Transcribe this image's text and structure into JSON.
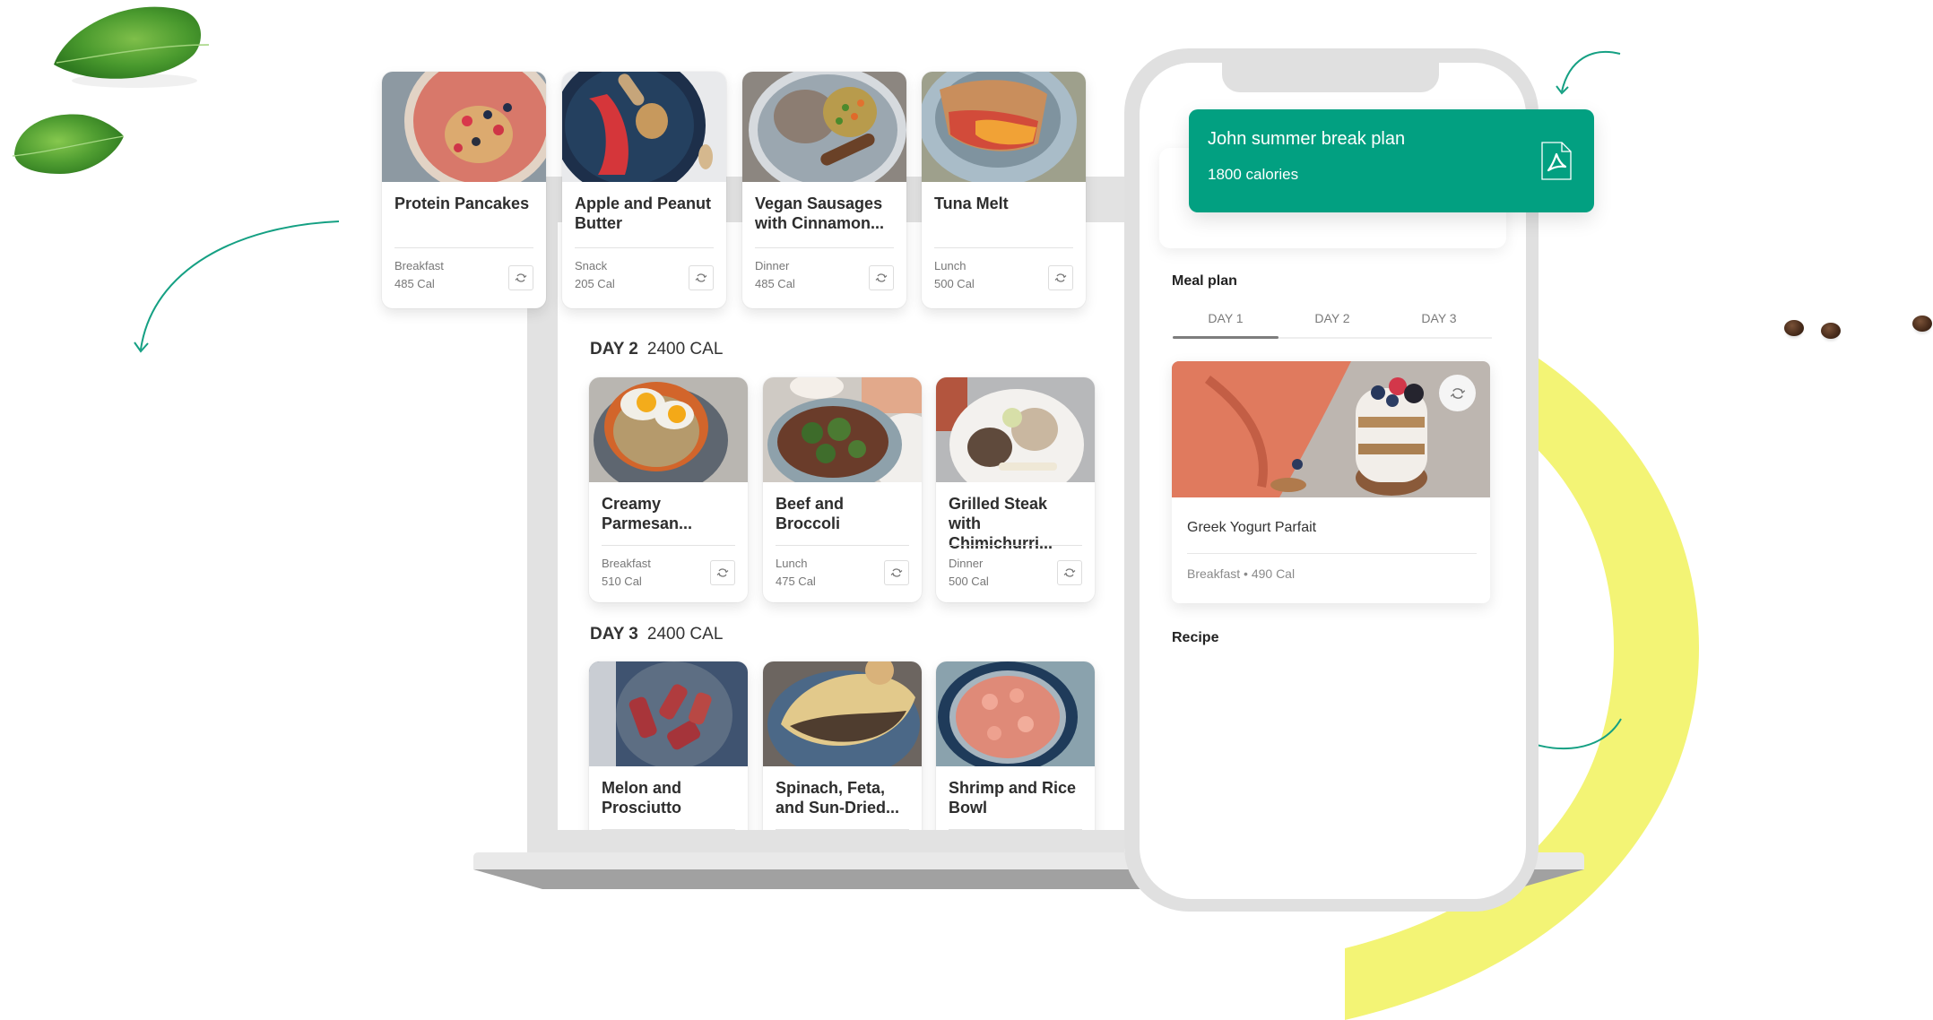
{
  "colors": {
    "brand_green": "#02a081",
    "accent_yellow": "#f3f475",
    "arrow_teal": "#15a083"
  },
  "carousel": {
    "cards": [
      {
        "title": "Protein Pancakes",
        "meal": "Breakfast",
        "calories": "485 Cal",
        "image": "pancakes-with-berries"
      },
      {
        "title": "Apple and Peanut Butter",
        "meal": "Snack",
        "calories": "205 Cal",
        "image": "sliced-apple-peanut-butter"
      },
      {
        "title": "Vegan Sausages with Cinnamon...",
        "meal": "Dinner",
        "calories": "485 Cal",
        "image": "vegan-sausage-plate"
      },
      {
        "title": "Tuna Melt",
        "meal": "Lunch",
        "calories": "500 Cal",
        "image": "tuna-melt-sandwich"
      }
    ]
  },
  "days": [
    {
      "label": "DAY 2",
      "calories": "2400 CAL",
      "meals": [
        {
          "title": "Creamy Parmesan...",
          "meal": "Breakfast",
          "calories": "510 Cal",
          "image": "egg-rice-bowl"
        },
        {
          "title": "Beef and Broccoli",
          "meal": "Lunch",
          "calories": "475 Cal",
          "image": "beef-broccoli-bowl"
        },
        {
          "title": "Grilled Steak with Chimichurri...",
          "meal": "Dinner",
          "calories": "500 Cal",
          "image": "steak-rice-plate"
        }
      ]
    },
    {
      "label": "DAY 3",
      "calories": "2400 CAL",
      "meals": [
        {
          "title": "Melon and Prosciutto",
          "image": "melon-prosciutto"
        },
        {
          "title": "Spinach, Feta, and Sun-Dried...",
          "image": "spinach-feta-omelette"
        },
        {
          "title": "Shrimp and Rice Bowl",
          "image": "shrimp-rice-bowl"
        }
      ]
    }
  ],
  "phone": {
    "plan": {
      "title": "John summer break plan",
      "calories": "1800 calories",
      "icon": "pdf-icon"
    },
    "meal_plan_label": "Meal plan",
    "tabs": [
      {
        "label": "DAY 1",
        "active": true
      },
      {
        "label": "DAY 2",
        "active": false
      },
      {
        "label": "DAY 3",
        "active": false
      }
    ],
    "featured_meal": {
      "title": "Greek Yogurt Parfait",
      "meta": "Breakfast • 490 Cal",
      "image": "greek-yogurt-parfait"
    },
    "recipe_label": "Recipe"
  }
}
